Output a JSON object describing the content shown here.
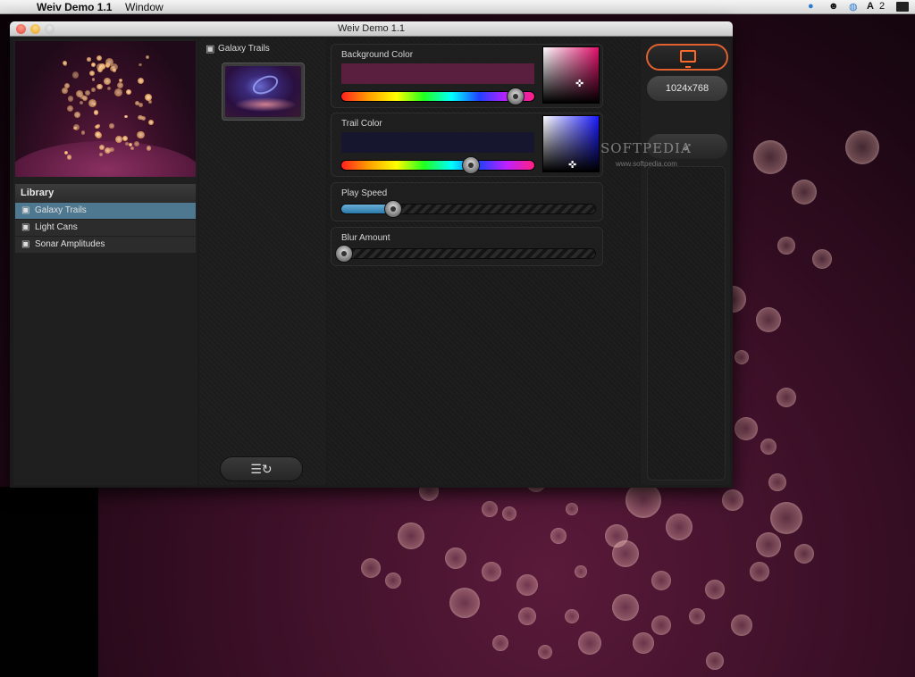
{
  "menubar": {
    "app_name": "Weiv Demo 1.1",
    "menu_window": "Window",
    "tray_number": "2"
  },
  "window": {
    "title": "Weiv Demo 1.1"
  },
  "library": {
    "header": "Library",
    "items": [
      {
        "label": "Galaxy Trails",
        "selected": true
      },
      {
        "label": "Light Cans",
        "selected": false
      },
      {
        "label": "Sonar Amplitudes",
        "selected": false
      }
    ]
  },
  "middle": {
    "selected_title": "Galaxy Trails"
  },
  "controls": {
    "background_color": {
      "label": "Background Color",
      "hue_value": 0.9,
      "swatch": "#5a1e3e"
    },
    "trail_color": {
      "label": "Trail Color",
      "hue_value": 0.65,
      "swatch": "#16162e"
    },
    "play_speed": {
      "label": "Play Speed",
      "value": 0.2
    },
    "blur_amount": {
      "label": "Blur Amount",
      "value": 0.0
    }
  },
  "right": {
    "resolution": "1024x768"
  },
  "watermark": {
    "text": "SOFTPEDIA",
    "url": "www.softpedia.com"
  },
  "colors": {
    "accent": "#e06030",
    "selected_row": "#4e7890"
  }
}
